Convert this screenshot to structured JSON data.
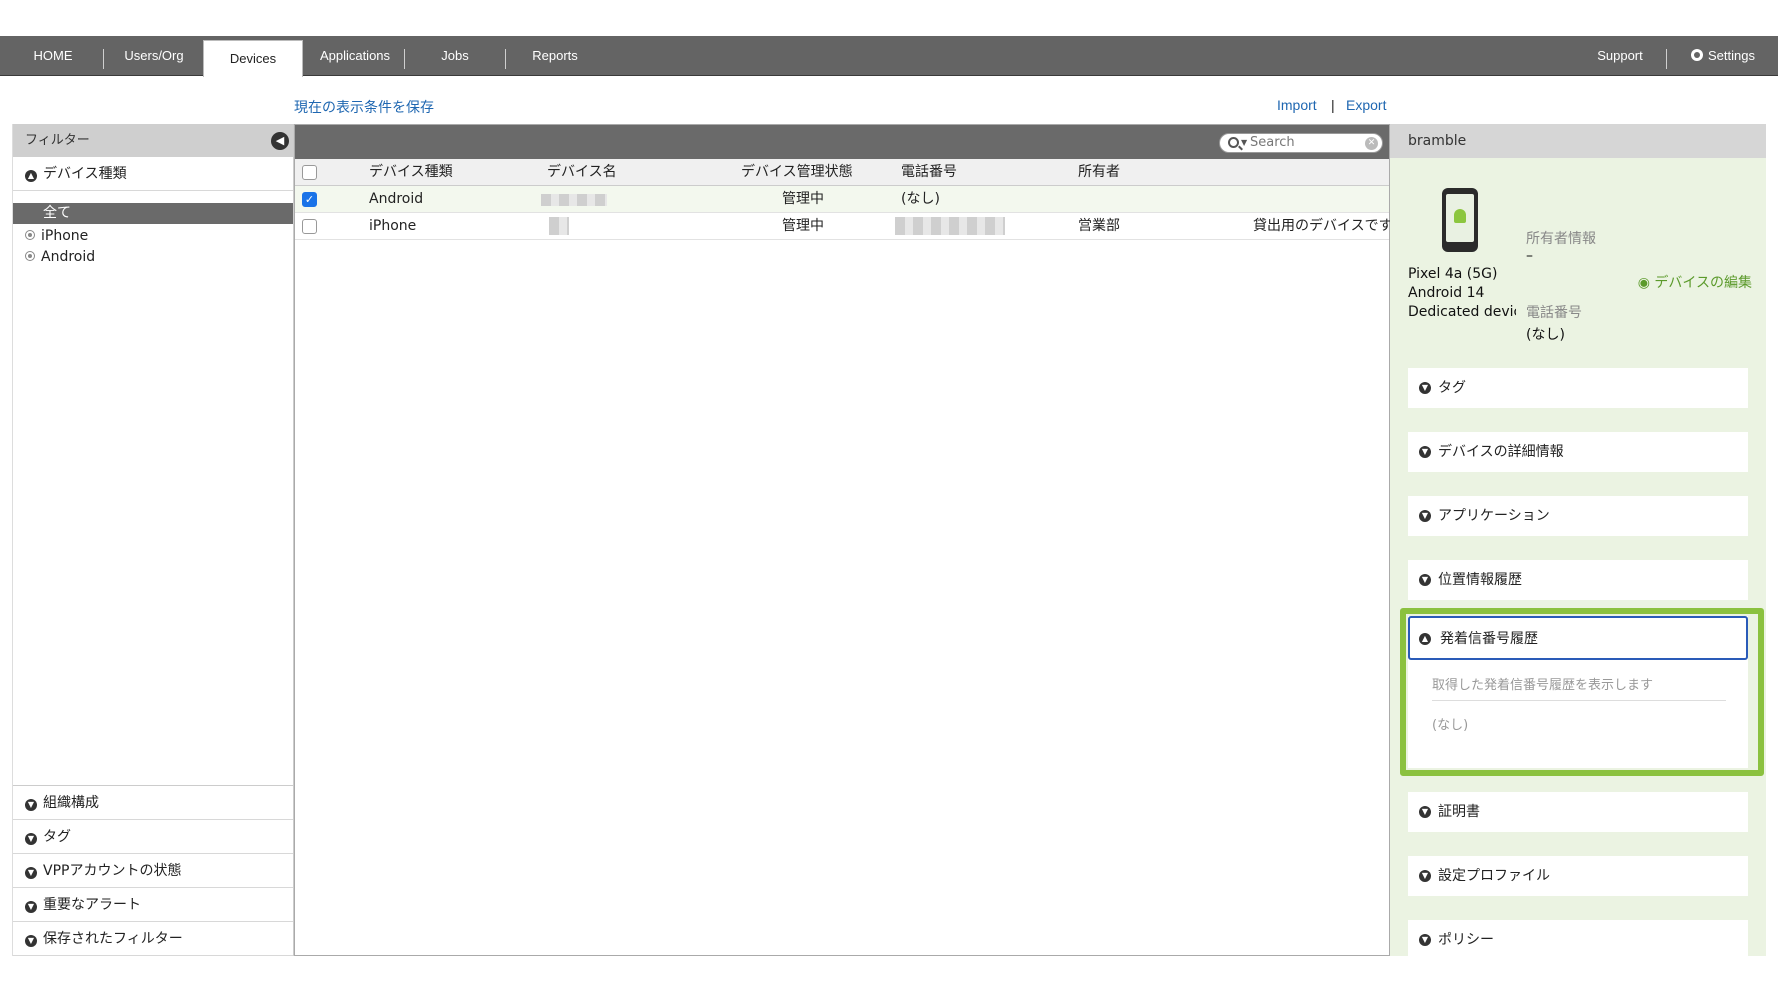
{
  "nav": {
    "tabs": [
      "HOME",
      "Users/Org",
      "Devices",
      "Applications",
      "Jobs",
      "Reports"
    ],
    "active_tab": "Devices",
    "support": "Support",
    "settings": "Settings"
  },
  "links": {
    "save_view": "現在の表示条件を保存",
    "import": "Import",
    "separator": "|",
    "export": "Export"
  },
  "filter": {
    "title": "フィルター",
    "device_type_header": "デバイス種類",
    "types": [
      "全て",
      "iPhone",
      "Android"
    ],
    "bottom_sections": [
      "組織構成",
      "タグ",
      "VPPアカウントの状態",
      "重要なアラート",
      "保存されたフィルター"
    ]
  },
  "table": {
    "search_placeholder": "Search",
    "columns": [
      "デバイス種類",
      "デバイス名",
      "デバイス管理状態",
      "電話番号",
      "所有者"
    ],
    "rows": [
      {
        "checked": true,
        "type": "Android",
        "status": "管理中",
        "phone": "(なし)",
        "owner": "",
        "note": ""
      },
      {
        "checked": false,
        "type": "iPhone",
        "status": "管理中",
        "phone": "",
        "owner": "営業部",
        "note": "貸出用のデバイスです"
      }
    ]
  },
  "detail": {
    "device_name": "bramble",
    "model": "Pixel 4a (5G)",
    "os": "Android 14",
    "mode": "Dedicated devic",
    "owner_label": "所有者情報",
    "owner_value": "–",
    "phone_label": "電話番号",
    "phone_value": "(なし)",
    "edit_link": "デバイスの編集",
    "sections_top": [
      "タグ",
      "デバイスの詳細情報",
      "アプリケーション",
      "位置情報履歴"
    ],
    "open_section": {
      "title": "発着信番号履歴",
      "description": "取得した発着信番号履歴を表示します",
      "value": "(なし)"
    },
    "sections_bottom": [
      "証明書",
      "設定プロファイル",
      "ポリシー"
    ]
  },
  "colors": {
    "nav_bg": "#646464",
    "link": "#1f67b1",
    "detail_bg": "#ebf3e2",
    "highlight": "#8bc13f",
    "accent_blue": "#2a5bb8"
  }
}
